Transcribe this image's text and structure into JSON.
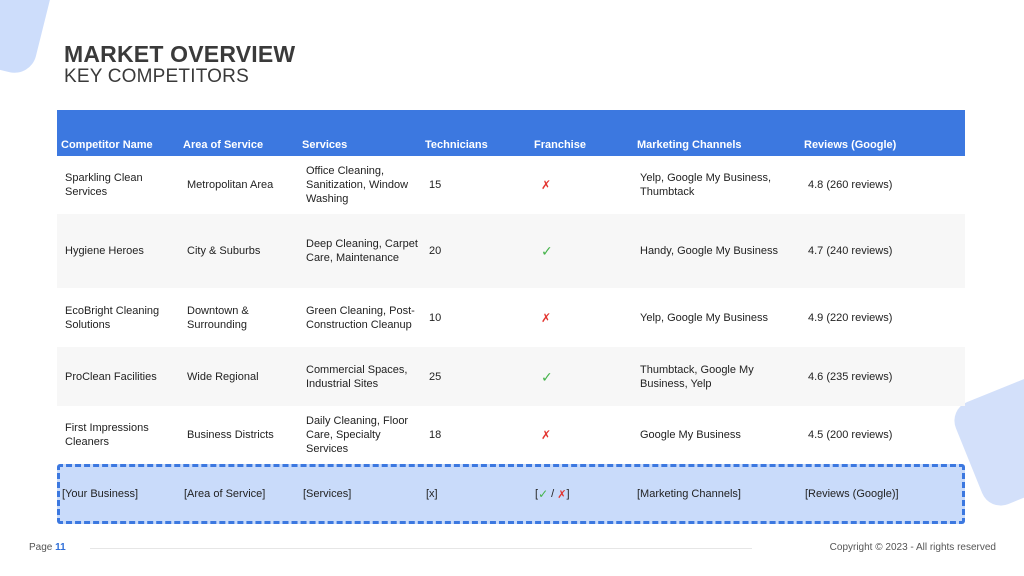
{
  "slide": {
    "title": "MARKET OVERVIEW",
    "subtitle": "KEY COMPETITORS"
  },
  "table": {
    "headers": [
      "Competitor Name",
      "Area of Service",
      "Services",
      "Technicians",
      "Franchise",
      "Marketing Channels",
      "Reviews (Google)"
    ],
    "rows": [
      {
        "name": "Sparkling Clean Services",
        "area": "Metropolitan Area",
        "services": "Office Cleaning, Sanitization, Window Washing",
        "technicians": "15",
        "franchise": "✗",
        "marketing": "Yelp, Google My Business, Thumbtack",
        "reviews": "4.8 (260 reviews)"
      },
      {
        "name": "Hygiene Heroes",
        "area": "City & Suburbs",
        "services": "Deep Cleaning, Carpet Care, Maintenance",
        "technicians": "20",
        "franchise": "✓",
        "marketing": "Handy, Google My Business",
        "reviews": "4.7 (240 reviews)"
      },
      {
        "name": "EcoBright Cleaning Solutions",
        "area": "Downtown & Surrounding",
        "services": "Green Cleaning, Post-Construction Cleanup",
        "technicians": "10",
        "franchise": "✗",
        "marketing": "Yelp, Google My Business",
        "reviews": "4.9 (220 reviews)"
      },
      {
        "name": "ProClean Facilities",
        "area": "Wide Regional",
        "services": "Commercial Spaces, Industrial Sites",
        "technicians": "25",
        "franchise": "✓",
        "marketing": "Thumbtack, Google My Business, Yelp",
        "reviews": "4.6 (235 reviews)"
      },
      {
        "name": "First Impressions Cleaners",
        "area": "Business Districts",
        "services": "Daily Cleaning, Floor Care, Specialty Services",
        "technicians": "18",
        "franchise": "✗",
        "marketing": "Google My Business",
        "reviews": "4.5 (200 reviews)"
      }
    ],
    "your_business": {
      "name": "[Your Business]",
      "area": "[Area of Service]",
      "services": "[Services]",
      "technicians": "[x]",
      "franchise_open": "[",
      "franchise_yes": "✓",
      "franchise_sep": " / ",
      "franchise_no": "✗",
      "franchise_close": "]",
      "marketing": "[Marketing Channels]",
      "reviews": "[Reviews (Google)]"
    }
  },
  "footer": {
    "page_label": "Page ",
    "page_number": "11",
    "copyright": "Copyright © 2023 - All rights reserved"
  },
  "colors": {
    "header_bg": "#3c78e0",
    "highlight_bg": "#c9dbfa",
    "check": "#44b34a",
    "cross": "#e3342f"
  }
}
